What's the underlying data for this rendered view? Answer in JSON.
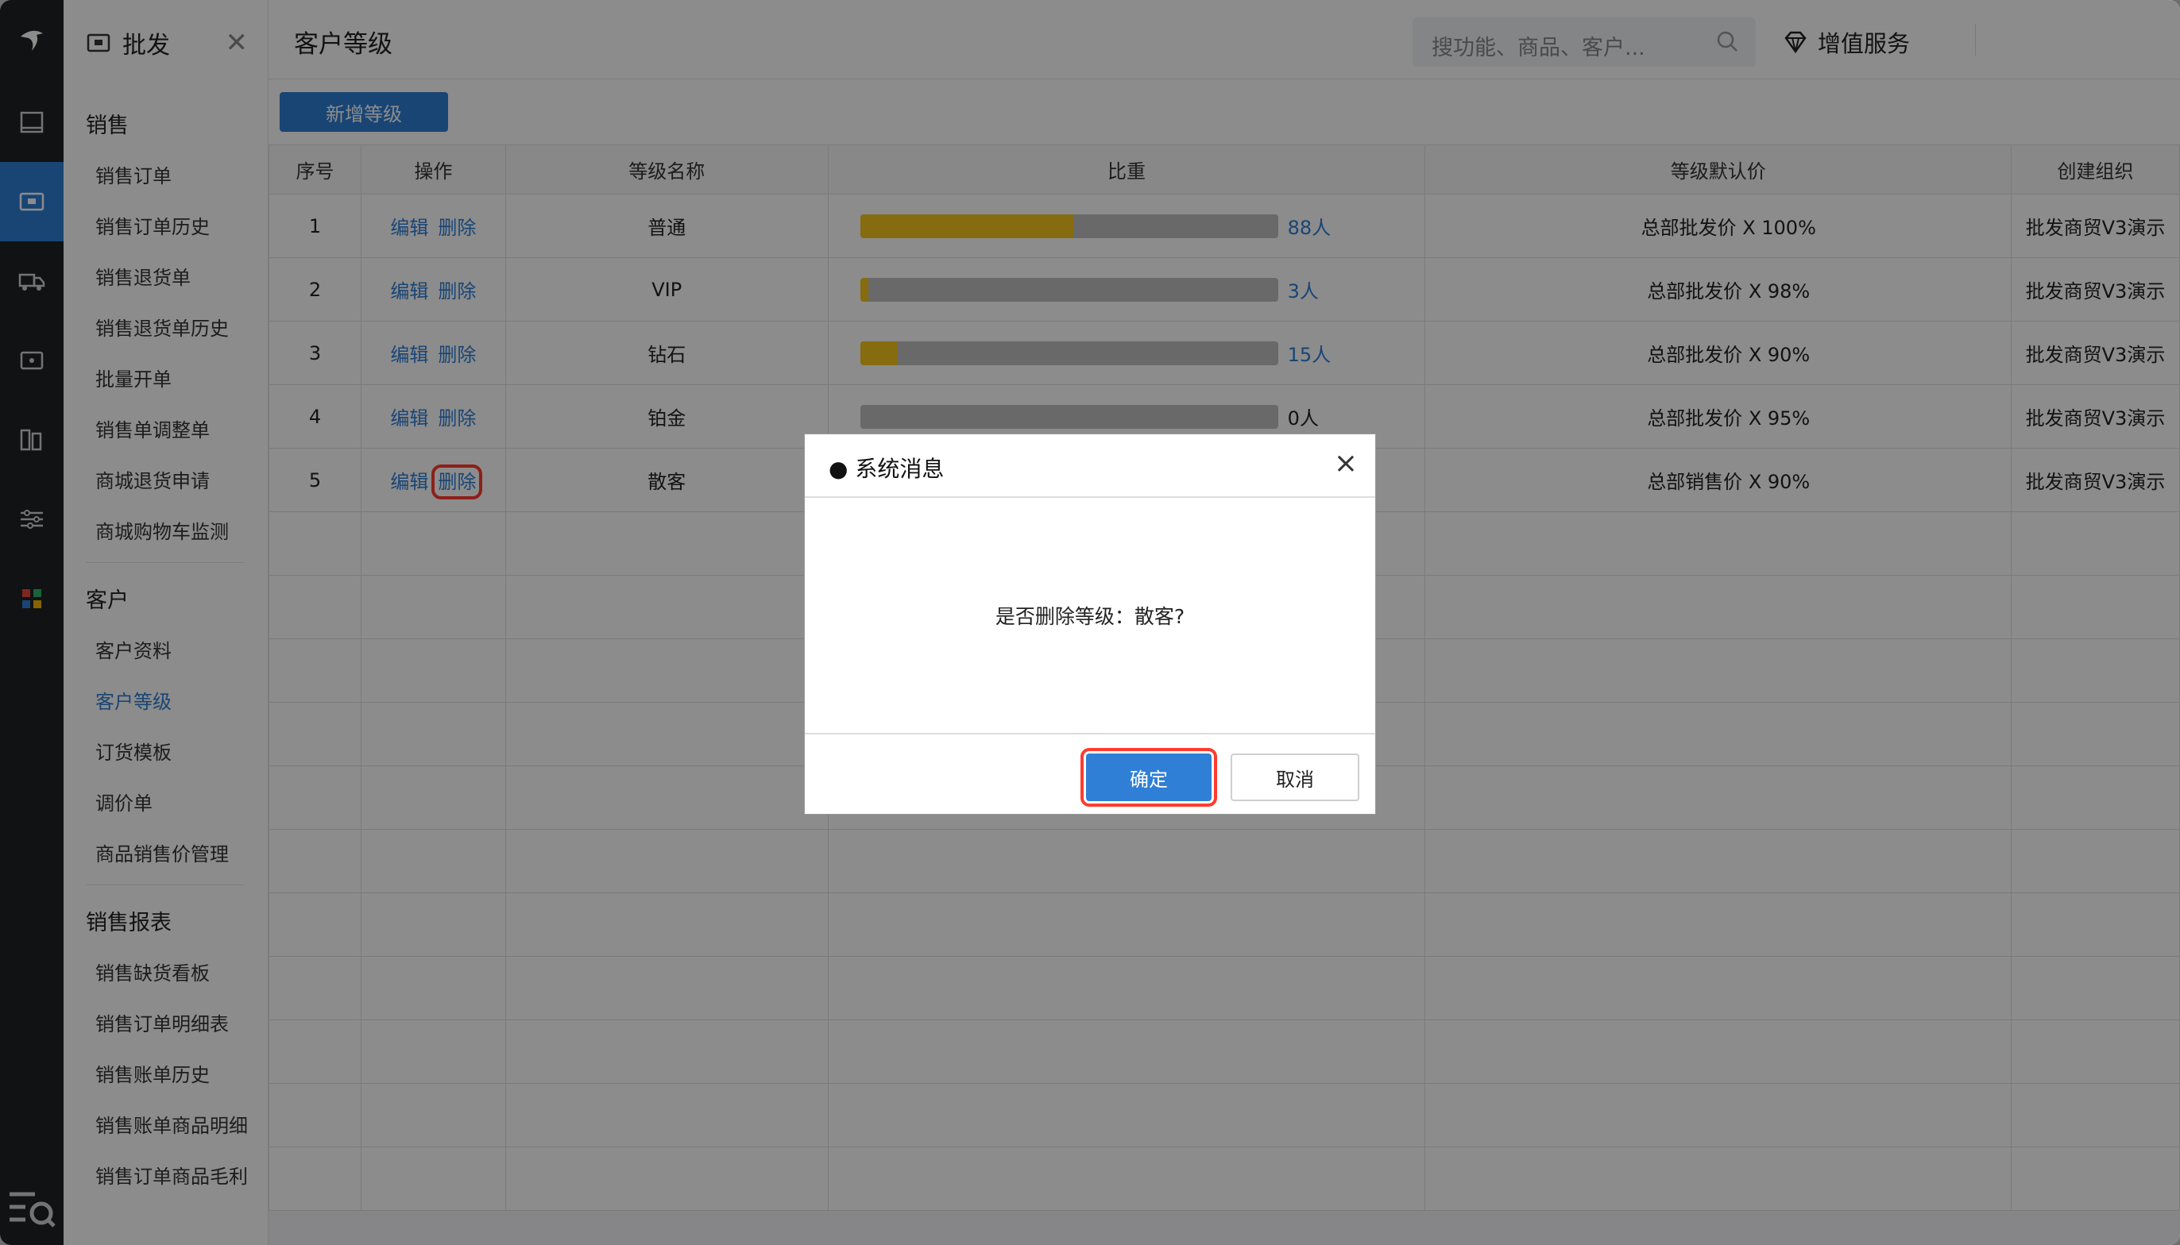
{
  "menu": {
    "title": "批发",
    "sections": [
      {
        "label": "销售",
        "items": [
          "销售订单",
          "销售订单历史",
          "销售退货单",
          "销售退货单历史",
          "批量开单",
          "销售单调整单",
          "商城退货申请",
          "商城购物车监测"
        ]
      },
      {
        "label": "客户",
        "items": [
          "客户资料",
          "客户等级",
          "订货模板",
          "调价单",
          "商品销售价管理"
        ]
      },
      {
        "label": "销售报表",
        "items": [
          "销售缺货看板",
          "销售订单明细表",
          "销售账单历史",
          "销售账单商品明细",
          "销售订单商品毛利"
        ]
      }
    ],
    "active_item": "客户等级"
  },
  "header": {
    "page_title": "客户等级",
    "search_placeholder": "搜功能、商品、客户...",
    "value_added": "增值服务"
  },
  "toolbar": {
    "new_label": "新增等级"
  },
  "table": {
    "columns": [
      "序号",
      "操作",
      "等级名称",
      "比重",
      "等级默认价",
      "创建组织"
    ],
    "edit_label": "编辑",
    "delete_label": "删除",
    "rows": [
      {
        "no": "1",
        "name": "普通",
        "ratio": 0.51,
        "count": "88人",
        "price": "总部批发价 X 100%",
        "org": "批发商贸V3演示"
      },
      {
        "no": "2",
        "name": "VIP",
        "ratio": 0.02,
        "count": "3人",
        "price": "总部批发价 X 98%",
        "org": "批发商贸V3演示"
      },
      {
        "no": "3",
        "name": "钻石",
        "ratio": 0.09,
        "count": "15人",
        "price": "总部批发价 X 90%",
        "org": "批发商贸V3演示"
      },
      {
        "no": "4",
        "name": "铂金",
        "ratio": 0,
        "count": "0人",
        "price": "总部批发价 X 95%",
        "org": "批发商贸V3演示"
      },
      {
        "no": "5",
        "name": "散客",
        "ratio": 0,
        "count": "",
        "price": "总部销售价 X 90%",
        "org": "批发商贸V3演示"
      }
    ]
  },
  "dialog": {
    "title": "● 系统消息",
    "message": "是否删除等级：散客?",
    "ok_label": "确定",
    "cancel_label": "取消"
  },
  "colors": {
    "accent": "#2f7fd6",
    "bar_fill": "#f4c51c",
    "highlight": "#ff3b30"
  }
}
